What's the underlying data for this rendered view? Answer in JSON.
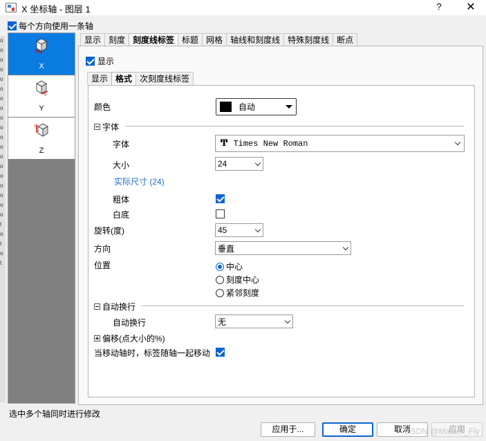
{
  "window": {
    "title": "X 坐标轴 - 图层 1",
    "help": "?",
    "close": "✕"
  },
  "left_strip": [
    "o",
    "o",
    "o",
    "o",
    "o",
    "o",
    "o",
    "o",
    "o",
    "o",
    "o",
    "o",
    "o",
    "o",
    "o",
    "o",
    "o",
    "o",
    "o",
    "t",
    "o",
    "t",
    "o",
    "t"
  ],
  "one_axis_per_direction": {
    "label": "每个方向使用一条轴",
    "checked": true
  },
  "axes": [
    {
      "label": "X",
      "selected": true
    },
    {
      "label": "Y",
      "selected": false
    },
    {
      "label": "Z",
      "selected": false
    }
  ],
  "outer_tabs": [
    "显示",
    "刻度",
    "刻度线标签",
    "标题",
    "网格",
    "轴线和刻度线",
    "特殊刻度线",
    "断点"
  ],
  "outer_active_tab": "刻度线标签",
  "show": {
    "label": "显示",
    "checked": true
  },
  "inner_tabs": [
    "显示",
    "格式",
    "次刻度线标签"
  ],
  "inner_active_tab": "格式",
  "format": {
    "color_label": "颜色",
    "color_value": "自动",
    "font_section": "字体",
    "font_label": "字体",
    "font_icon": "Ͳ",
    "font_value": "Times New Roman",
    "size_label": "大小",
    "size_value": "24",
    "actual_size": "实际尺寸 (24)",
    "bold_label": "粗体",
    "bold_checked": true,
    "white_bg_label": "白底",
    "white_bg_checked": false,
    "rotation_label": "旋转(度)",
    "rotation_value": "45",
    "direction_label": "方向",
    "direction_value": "垂直",
    "position_label": "位置",
    "position_options": [
      "中心",
      "刻度中心",
      "紧邻刻度"
    ],
    "position_selected": 0,
    "wrap_section": "自动换行",
    "wrap_label": "自动换行",
    "wrap_value": "无",
    "offset_section": "偏移(点大小的%)",
    "move_label": "当移动轴时，标签随轴一起移动",
    "move_checked": true
  },
  "status_text": "选中多个轴同时进行修改",
  "buttons": {
    "apply_to": "应用于...",
    "ok": "确定",
    "cancel": "取消",
    "apply": "应用"
  },
  "watermark": "CSDN @Master_Fly",
  "colors": {
    "accent": "#0a64d2",
    "selection": "#0a7be0"
  }
}
